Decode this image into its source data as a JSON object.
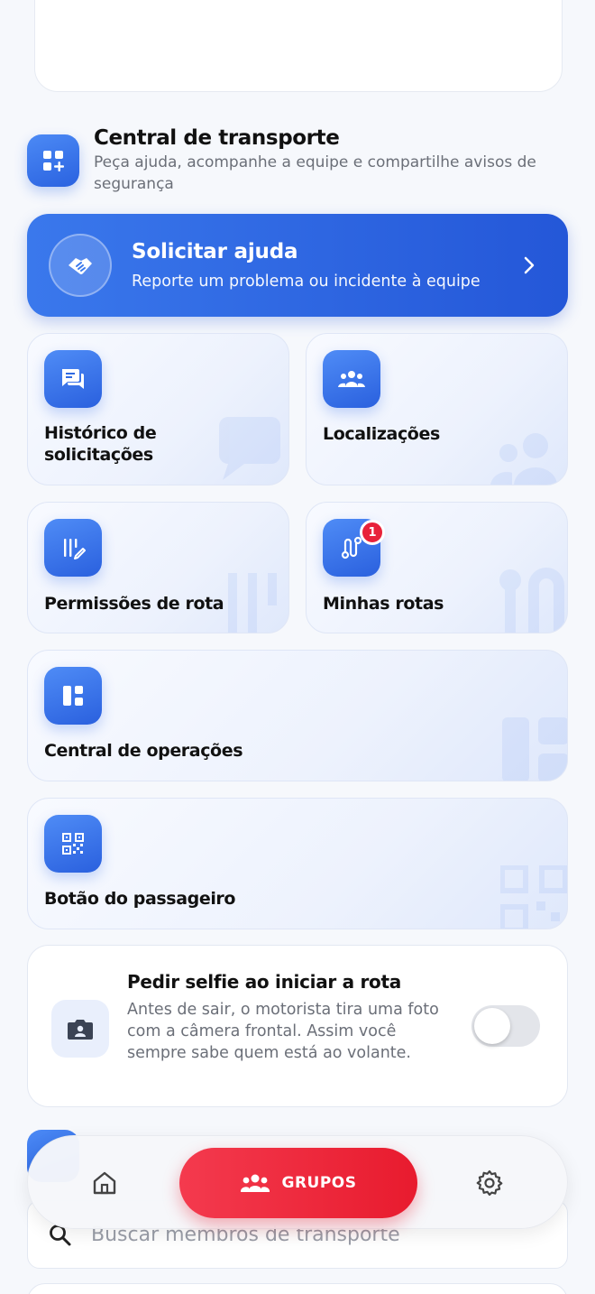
{
  "section": {
    "title": "Central de transporte",
    "subtitle": "Peça ajuda, acompanhe a equipe e compartilhe avisos de segurança",
    "icon": "grid-plus-icon"
  },
  "help_banner": {
    "title": "Solicitar ajuda",
    "subtitle": "Reporte um problema ou incidente à equipe",
    "icon": "handshake-icon"
  },
  "tiles": [
    {
      "label": "Histórico de solicitações",
      "icon": "chat-bubbles-icon"
    },
    {
      "label": "Localizações",
      "icon": "group-icon"
    },
    {
      "label": "Permissões de rota",
      "icon": "permissions-icon"
    },
    {
      "label": "Minhas rotas",
      "icon": "route-icon",
      "badge": "1"
    },
    {
      "label": "Central de operações",
      "icon": "dashboard-icon"
    },
    {
      "label": "Botão do passageiro",
      "icon": "qr-code-icon"
    }
  ],
  "selfie": {
    "title": "Pedir selfie ao iniciar a rota",
    "description": "Antes de sair, o motorista tira uma foto com a câmera frontal. Assim você sempre sabe quem está ao volante.",
    "enabled": false
  },
  "search": {
    "placeholder": "Buscar membros de transporte",
    "value": ""
  },
  "bottom_nav": {
    "home_icon": "home-icon",
    "groups_label": "GRUPOS",
    "settings_icon": "gear-icon"
  },
  "colors": {
    "primary_blue": "#2a62e0",
    "accent_red": "#e81b2e"
  }
}
